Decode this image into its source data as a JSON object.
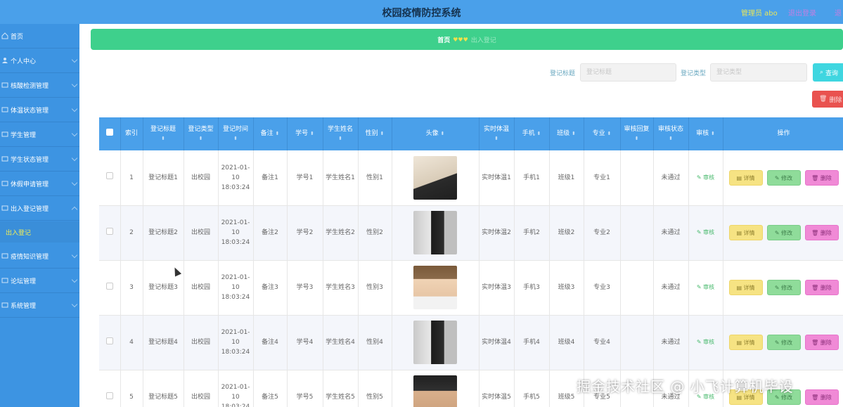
{
  "header": {
    "title": "校园疫情防控系统",
    "user": "管理员 abo",
    "exit": "退出登录",
    "exit2": "退"
  },
  "sidebar": {
    "items": [
      {
        "label": "首页",
        "icon": "home-icon"
      },
      {
        "label": "个人中心",
        "icon": "user-icon"
      },
      {
        "label": "核酸检测管理",
        "icon": "test-icon"
      },
      {
        "label": "体温状态管理",
        "icon": "thermometer-icon"
      },
      {
        "label": "学生管理",
        "icon": "student-icon"
      },
      {
        "label": "学生状态管理",
        "icon": "status-icon"
      },
      {
        "label": "休假申请管理",
        "icon": "leave-icon"
      },
      {
        "label": "出入登记管理",
        "icon": "entry-icon"
      },
      {
        "label": "疫情知识管理",
        "icon": "knowledge-icon"
      },
      {
        "label": "论坛管理",
        "icon": "forum-icon"
      },
      {
        "label": "系统管理",
        "icon": "system-icon"
      }
    ],
    "submenu": "出入登记"
  },
  "breadcrumb": {
    "home": "首页",
    "sep": "♥♥♥",
    "current": "出入登记"
  },
  "search": {
    "label1": "登记标题",
    "placeholder1": "登记标题",
    "label2": "登记类型",
    "placeholder2": "登记类型",
    "search_button": "查询",
    "delete_button": "删除"
  },
  "table": {
    "headers": [
      "索引",
      "登记标题",
      "登记类型",
      "登记时间",
      "备注",
      "学号",
      "学生姓名",
      "性别",
      "头像",
      "实时体温",
      "手机",
      "班级",
      "专业",
      "审核回复",
      "审核状态",
      "审核",
      "操作"
    ],
    "rows": [
      {
        "index": "1",
        "title": "登记标题1",
        "type": "出校园",
        "time": "2021-01-10 18:03:24",
        "note": "备注1",
        "sid": "学号1",
        "name": "学生姓名1",
        "gender": "性别1",
        "temp": "实时体温1",
        "phone": "手机1",
        "class": "班级1",
        "major": "专业1",
        "reply": "",
        "status": "未通过",
        "audit": "审核"
      },
      {
        "index": "2",
        "title": "登记标题2",
        "type": "出校园",
        "time": "2021-01-10 18:03:24",
        "note": "备注2",
        "sid": "学号2",
        "name": "学生姓名2",
        "gender": "性别2",
        "temp": "实时体温2",
        "phone": "手机2",
        "class": "班级2",
        "major": "专业2",
        "reply": "",
        "status": "未通过",
        "audit": "审核"
      },
      {
        "index": "3",
        "title": "登记标题3",
        "type": "出校园",
        "time": "2021-01-10 18:03:24",
        "note": "备注3",
        "sid": "学号3",
        "name": "学生姓名3",
        "gender": "性别3",
        "temp": "实时体温3",
        "phone": "手机3",
        "class": "班级3",
        "major": "专业3",
        "reply": "",
        "status": "未通过",
        "audit": "审核"
      },
      {
        "index": "4",
        "title": "登记标题4",
        "type": "出校园",
        "time": "2021-01-10 18:03:24",
        "note": "备注4",
        "sid": "学号4",
        "name": "学生姓名4",
        "gender": "性别4",
        "temp": "实时体温4",
        "phone": "手机4",
        "class": "班级4",
        "major": "专业4",
        "reply": "",
        "status": "未通过",
        "audit": "审核"
      },
      {
        "index": "5",
        "title": "登记标题5",
        "type": "出校园",
        "time": "2021-01-10 18:03:24",
        "note": "备注5",
        "sid": "学号5",
        "name": "学生姓名5",
        "gender": "性别5",
        "temp": "实时体温5",
        "phone": "手机5",
        "class": "班级5",
        "major": "专业5",
        "reply": "",
        "status": "未通过",
        "audit": "审核"
      }
    ],
    "actions": {
      "detail": "详情",
      "edit": "修改",
      "delete": "删除"
    }
  },
  "watermark": "掘金技术社区 @ 小飞计算机毕设",
  "colors": {
    "header": "#4aa0ea",
    "sidebar": "#3d94e2",
    "breadcrumb": "#3ed08c",
    "search_button": "#3fd6e0",
    "delete_button": "#e9524f"
  }
}
